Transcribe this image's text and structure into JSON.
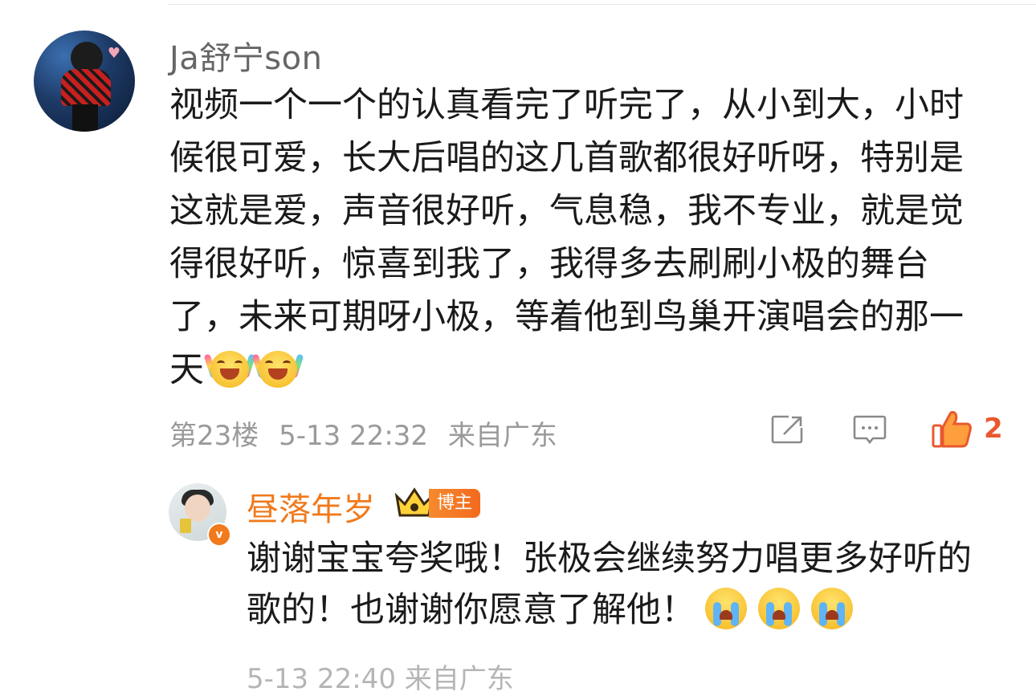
{
  "comment": {
    "username": "Ja舒宁son",
    "text": "视频一个一个的认真看完了听完了，从小到大，小时候很可爱，长大后唱的这几首歌都很好听呀，特别是这就是爱，声音很好听，气息稳，我不专业，就是觉得很好听，惊喜到我了，我得多去刷刷小极的舞台了，未来可期呀小极，等着他到鸟巢开演唱会的那一天",
    "emojis": [
      "laugh-tears-emoji",
      "laugh-tears-emoji"
    ],
    "floor": "第23楼",
    "time": "5-13 22:32",
    "location": "来自广东",
    "like_count": "2",
    "like_color": "#e8592e"
  },
  "reply": {
    "username": "昼落年岁",
    "badge_label": "博主",
    "verified_mark": "v",
    "text": "谢谢宝宝夸奖哦！张极会继续努力唱更多好听的歌的！也谢谢你愿意了解他！",
    "emojis": [
      "crying-emoji",
      "crying-emoji",
      "crying-emoji"
    ],
    "name_color": "#f07a1c",
    "meta_partial": "5-13 22:40  来自广东"
  },
  "icons": {
    "share": "share-icon",
    "reply": "comment-icon",
    "like": "thumbs-up-icon"
  }
}
